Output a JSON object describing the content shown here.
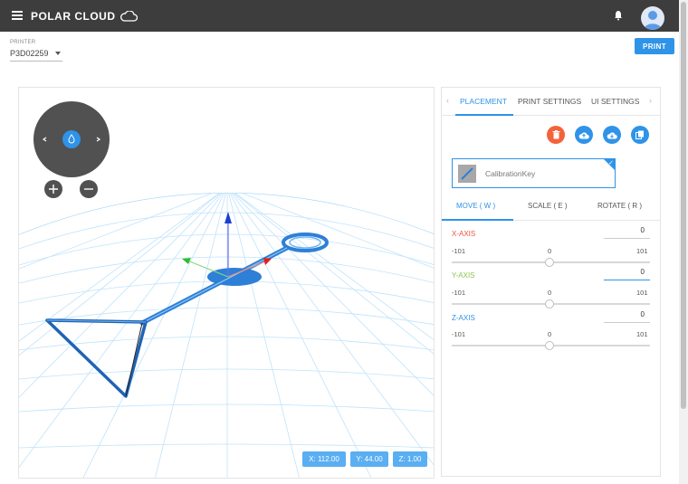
{
  "app": {
    "brand": "POLAR CLOUD"
  },
  "printer": {
    "label": "PRINTER",
    "value": "P3D02259"
  },
  "actions": {
    "print_label": "PRINT"
  },
  "panel": {
    "tabs": [
      "PLACEMENT",
      "PRINT SETTINGS",
      "UI SETTINGS"
    ],
    "active_tab": "PLACEMENT",
    "model_name": "CalibrationKey",
    "modes": [
      "MOVE ( W )",
      "SCALE ( E )",
      "ROTATE ( R )"
    ],
    "active_mode": "MOVE ( W )",
    "axes": [
      {
        "label": "X-AXIS",
        "value": "0",
        "min": "-101",
        "mid": "0",
        "max": "101",
        "color": "#e9573f",
        "position": 0.5
      },
      {
        "label": "Y-AXIS",
        "value": "0",
        "min": "-101",
        "mid": "0",
        "max": "101",
        "color": "#8cc152",
        "position": 0.5
      },
      {
        "label": "Z-AXIS",
        "value": "0",
        "min": "-101",
        "mid": "0",
        "max": "101",
        "color": "#2f93e8",
        "position": 0.5
      }
    ]
  },
  "viewport": {
    "coords": {
      "x": "X: 112.00",
      "y": "Y: 44.00",
      "z": "Z: 1.00"
    }
  },
  "colors": {
    "accent": "#2f93e8",
    "delete": "#f4623a",
    "topbar": "#3d3d3d"
  }
}
